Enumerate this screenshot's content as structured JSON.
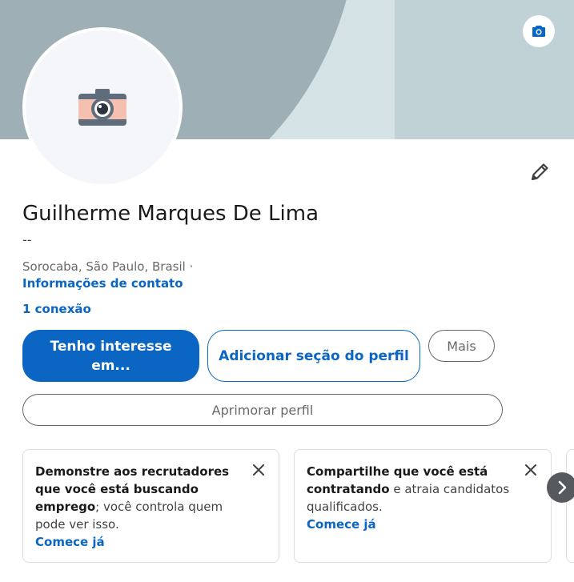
{
  "profile": {
    "name": "Guilherme Marques De Lima",
    "headline": "--",
    "location": "Sorocaba, São Paulo, Brasil ·",
    "contact_link": "Informações de contato",
    "connections": "1 conexão"
  },
  "icons": {
    "banner_camera": "camera-icon",
    "avatar_placeholder": "camera-illustration-icon",
    "edit": "pencil-icon",
    "close": "close-icon",
    "next": "chevron-right-icon"
  },
  "actions": {
    "open_to": "Tenho interesse em...",
    "add_section": "Adicionar seção do perfil",
    "more": "Mais",
    "improve": "Aprimorar perfil"
  },
  "cards": [
    {
      "bold_text": "Demonstre aos recrutadores que você está buscando emprego",
      "rest_text": "; você controla quem pode ver isso.",
      "link": "Comece já"
    },
    {
      "bold_text": "Compartilhe que você está contratando",
      "rest_text": " e atraia candidatos qualificados.",
      "link": "Comece já"
    }
  ],
  "colors": {
    "accent": "#0a66c2",
    "banner": "#9eb0b5",
    "banner_light": "#d6e3e6"
  }
}
